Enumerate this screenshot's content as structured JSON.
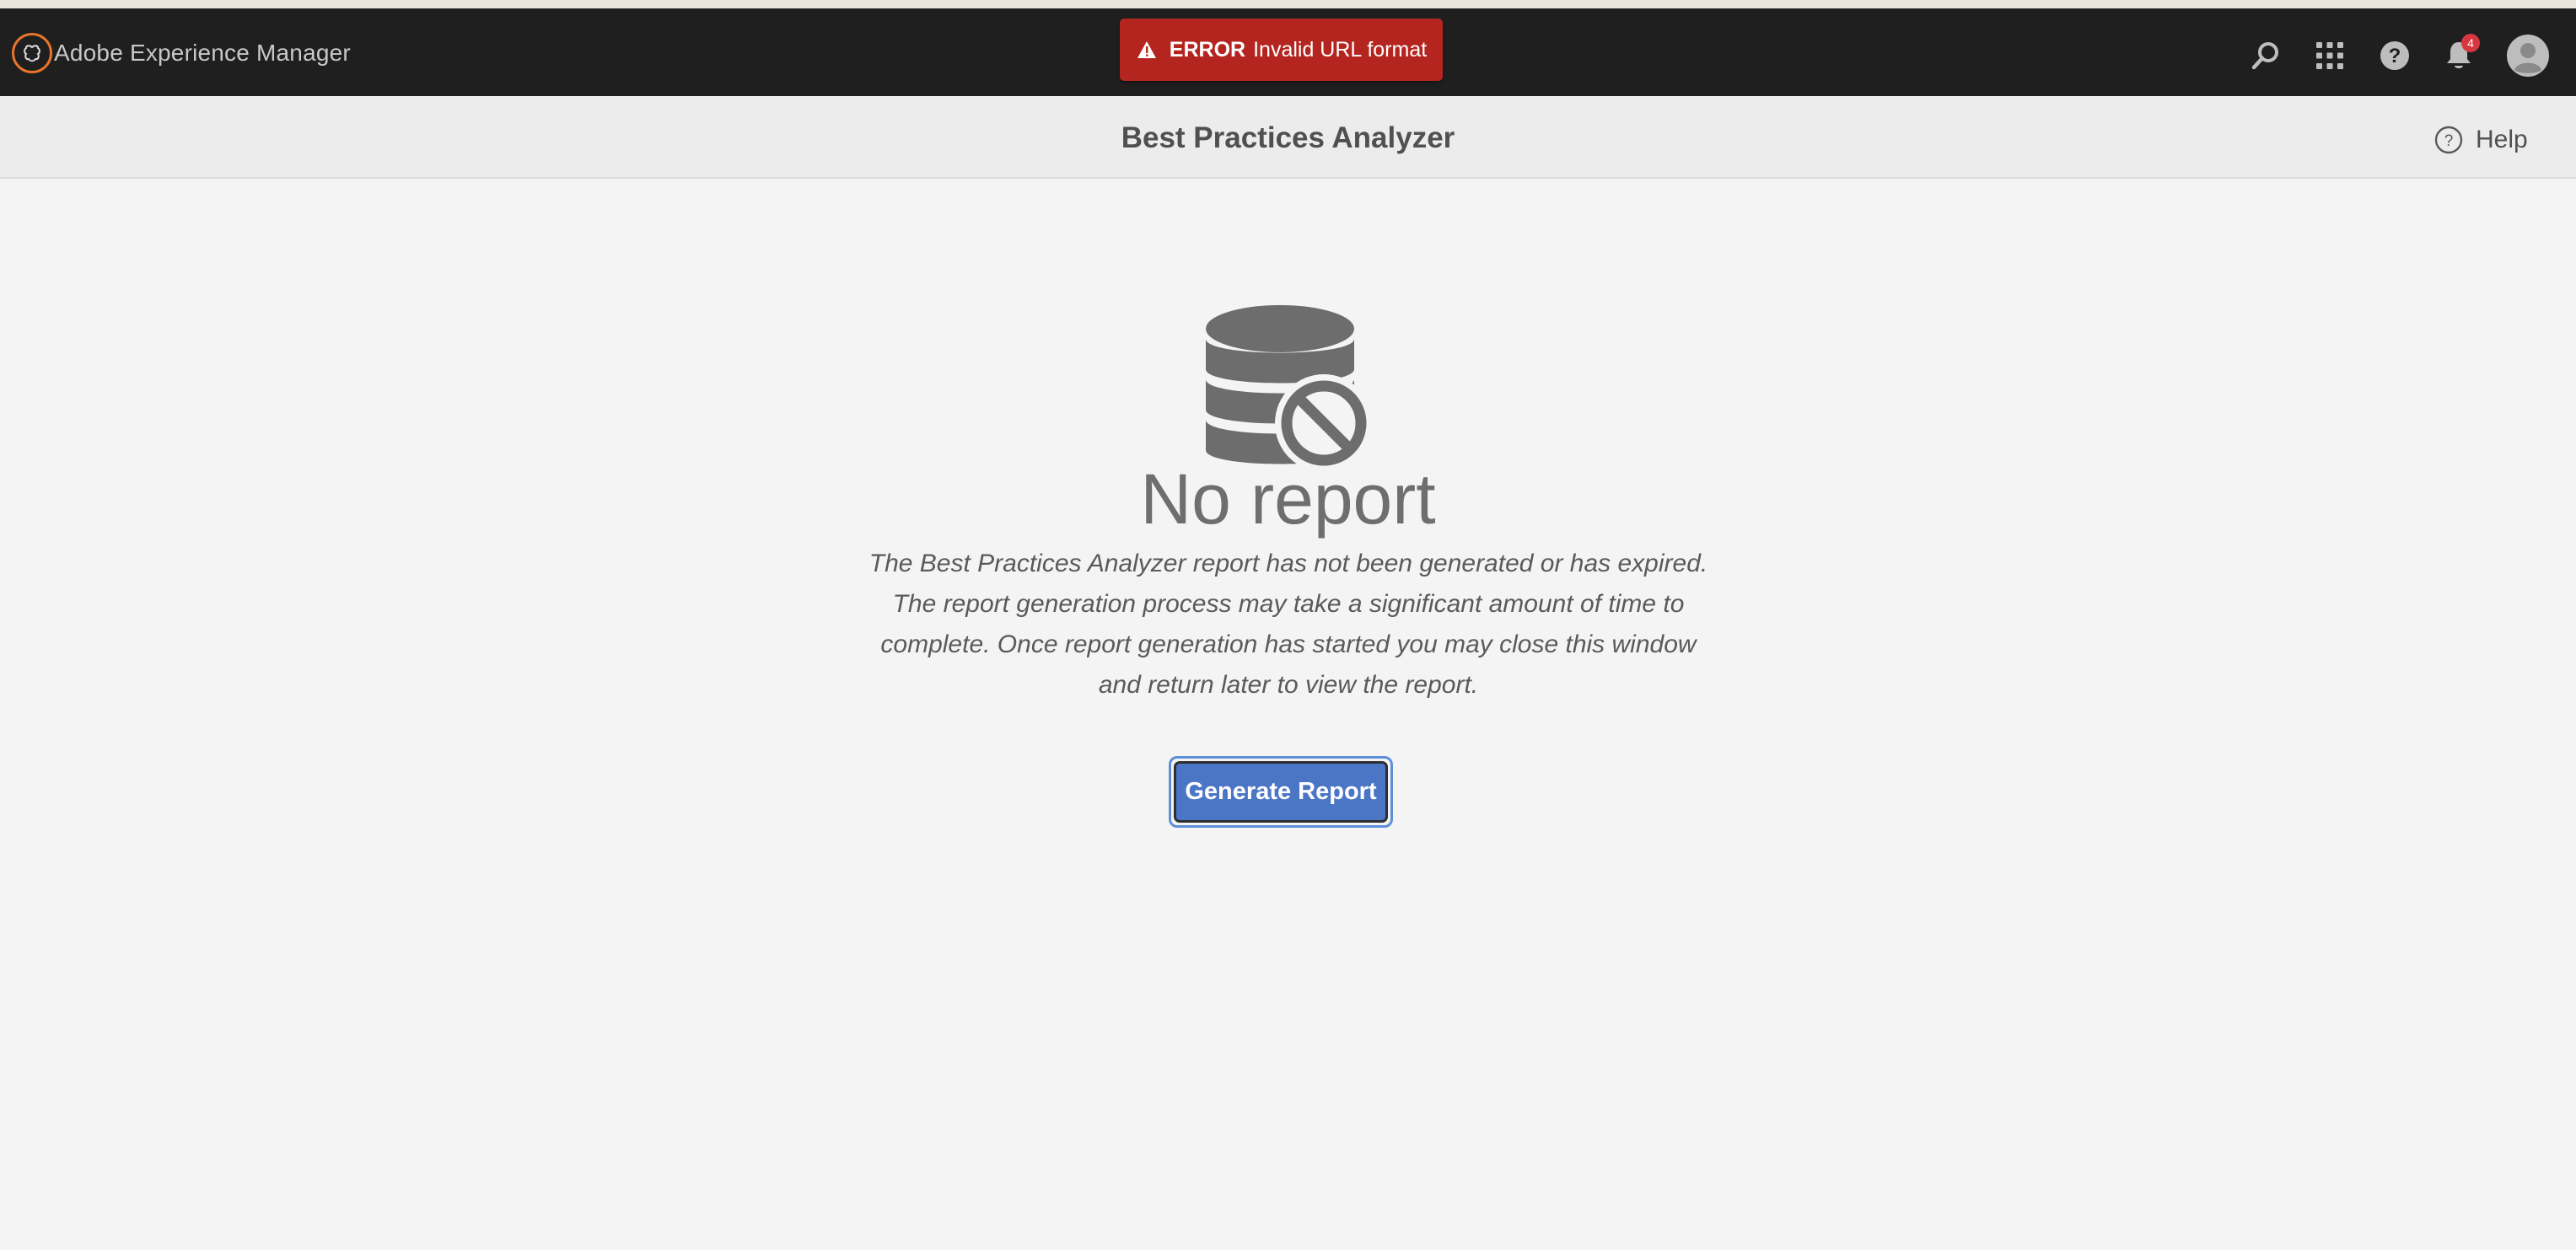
{
  "app": {
    "brand_name": "Adobe Experience Manager",
    "brand_icon": "adobe-experience-manager-logo"
  },
  "toast": {
    "type": "error",
    "label": "ERROR",
    "message": "Invalid URL format",
    "icon": "alert-triangle-icon",
    "color": "#b5251f"
  },
  "header_actions": {
    "search_icon": "search-icon",
    "apps_icon": "grid-icon",
    "help_icon": "help-icon",
    "notifications_icon": "bell-icon",
    "notifications_count": "4",
    "profile_icon": "avatar"
  },
  "action_bar": {
    "title": "Best Practices Analyzer",
    "help_label": "Help"
  },
  "empty_state": {
    "icon": "database-unavailable-icon",
    "heading": "No report",
    "description": "The Best Practices Analyzer report has not been generated or has expired. The report generation process may take a significant amount of time to complete. Once report generation has started you may close this window and return later to view the report.",
    "button_label": "Generate Report",
    "button_color": "#4b75c5"
  }
}
